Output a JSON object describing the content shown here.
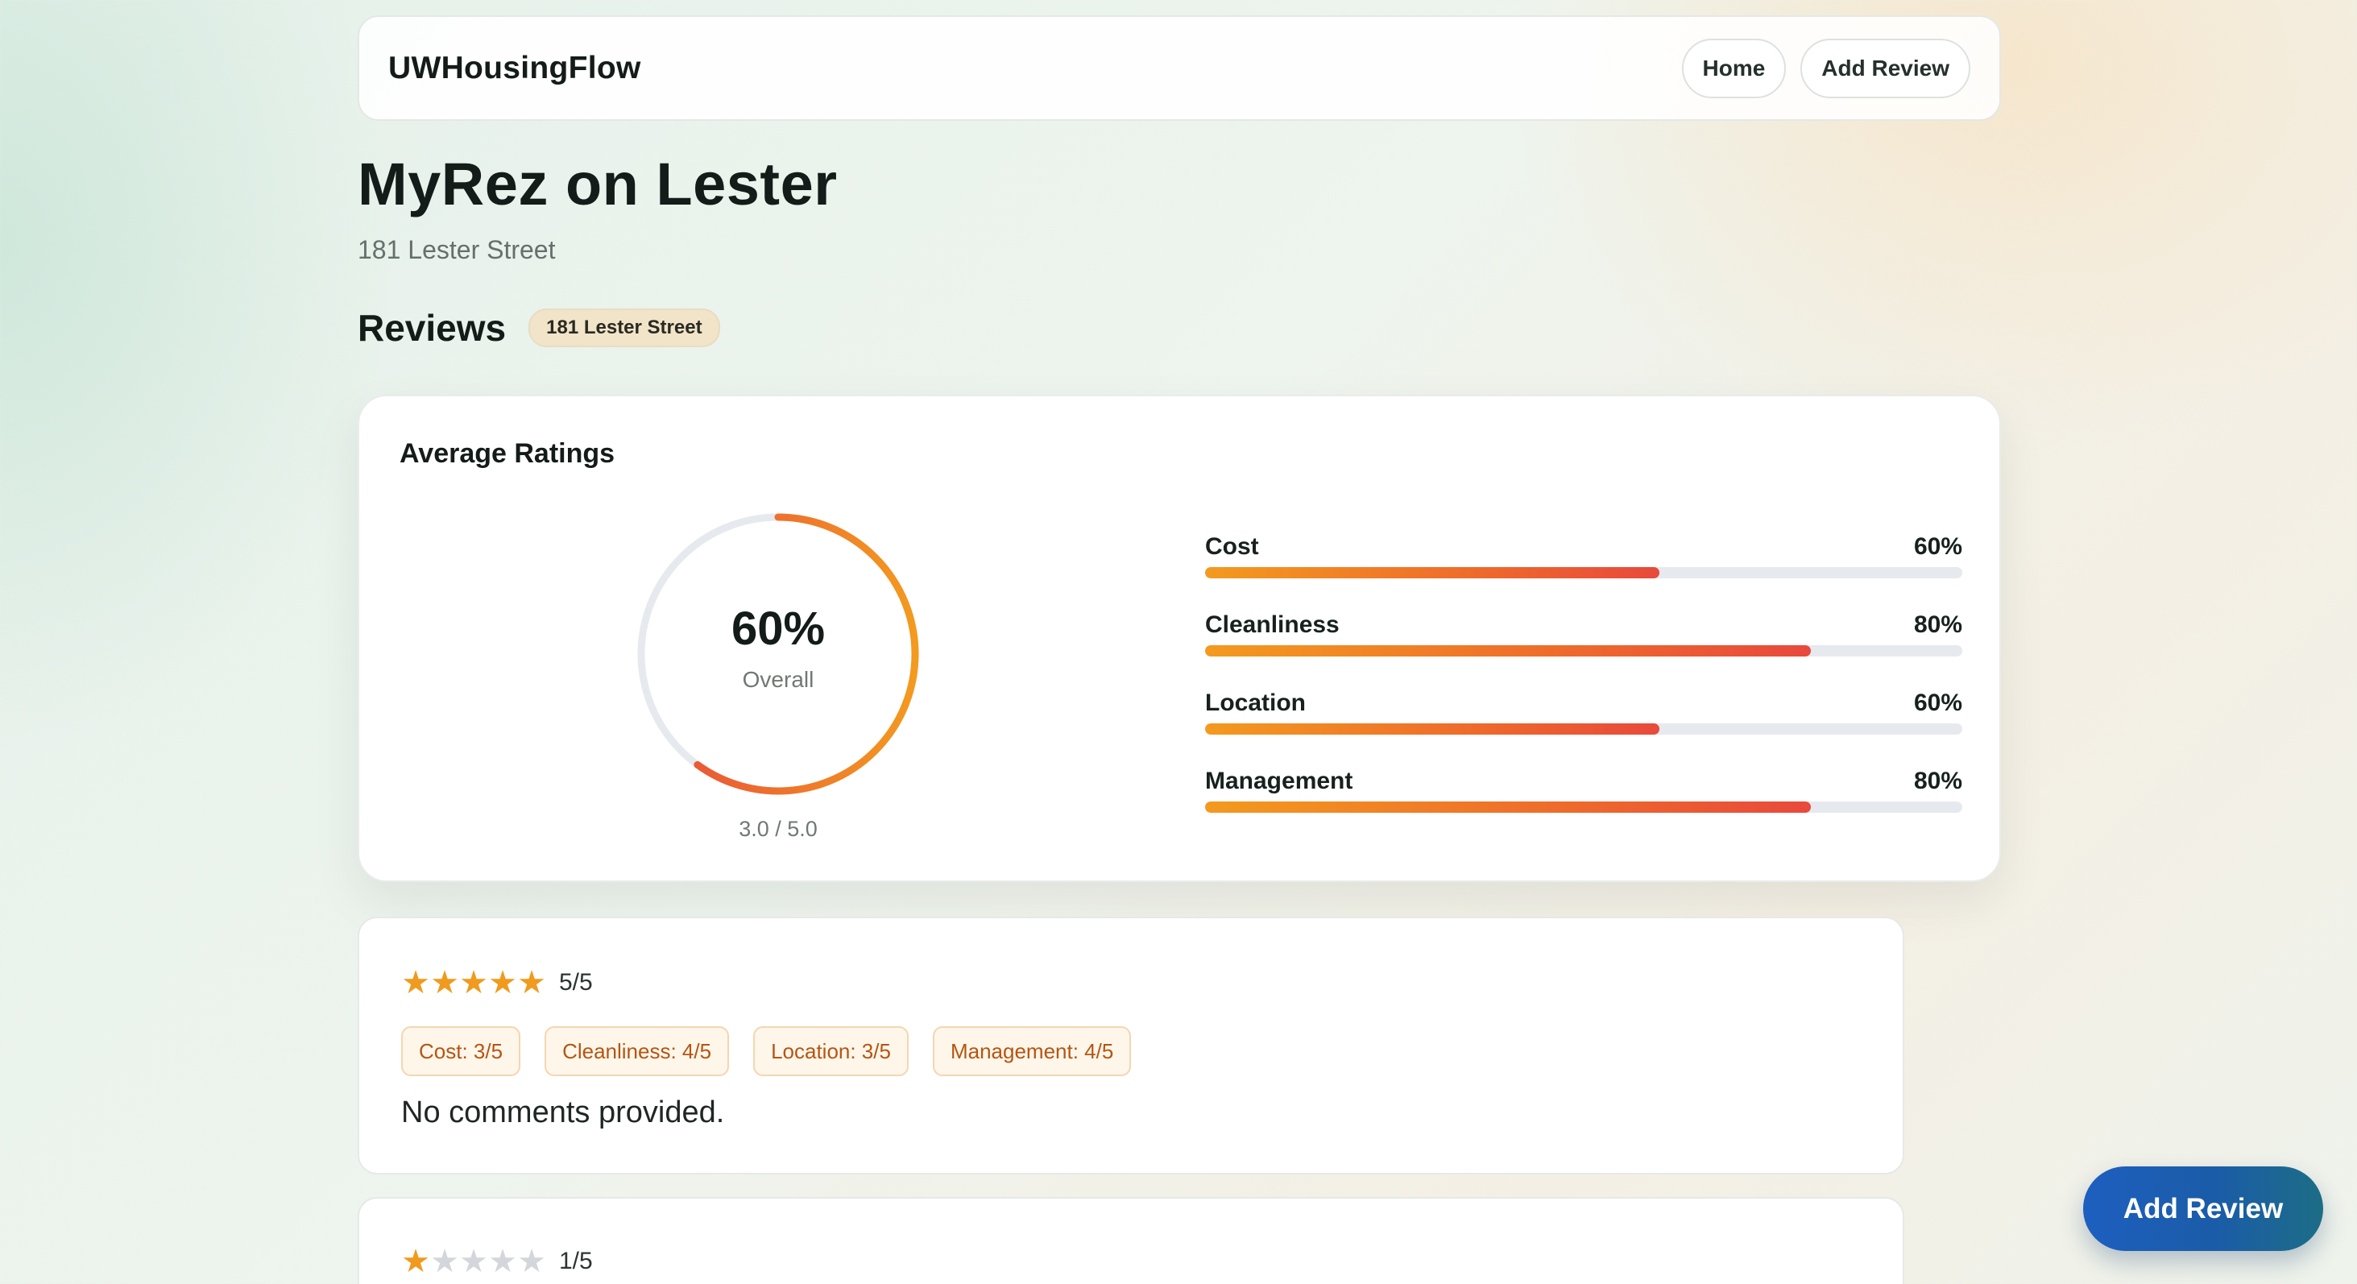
{
  "header": {
    "brand": "UWHousingFlow",
    "nav": [
      "Home",
      "Add Review"
    ]
  },
  "property": {
    "name": "MyRez on Lester",
    "address": "181 Lester Street"
  },
  "reviews_section": {
    "heading": "Reviews",
    "badge": "181 Lester Street"
  },
  "average": {
    "title": "Average Ratings",
    "overall_label": "60%",
    "overall_fraction": 0.6,
    "overall_sub": "Overall",
    "score_text": "3.0 / 5.0",
    "categories": [
      {
        "label": "Cost",
        "value_text": "60%",
        "fraction": 0.6
      },
      {
        "label": "Cleanliness",
        "value_text": "80%",
        "fraction": 0.8
      },
      {
        "label": "Location",
        "value_text": "60%",
        "fraction": 0.6
      },
      {
        "label": "Management",
        "value_text": "80%",
        "fraction": 0.8
      }
    ]
  },
  "reviews": [
    {
      "stars": 5,
      "score_text": "5/5",
      "chips": [
        "Cost: 3/5",
        "Cleanliness: 4/5",
        "Location: 3/5",
        "Management: 4/5"
      ],
      "comment": "No comments provided."
    },
    {
      "stars": 1,
      "score_text": "1/5"
    }
  ],
  "fab": {
    "label": "Add Review"
  },
  "colors": {
    "accent_orange": "#f09a1e",
    "accent_red": "#e8493c",
    "fab_blue": "#1d5fbf"
  }
}
